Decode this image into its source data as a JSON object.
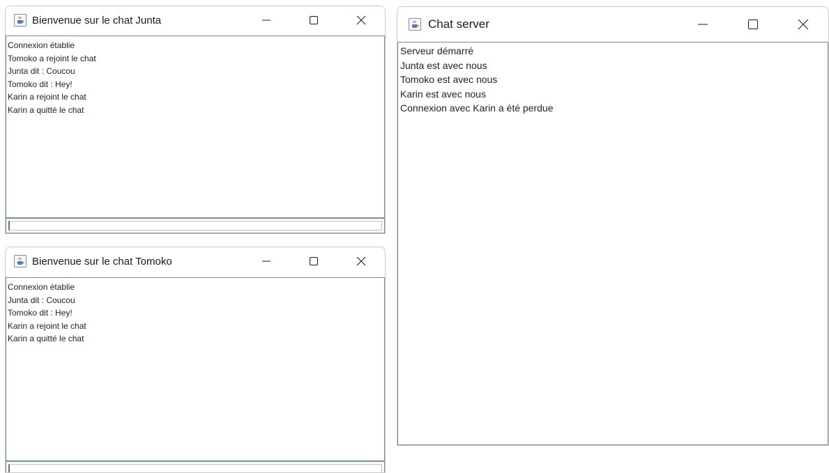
{
  "windows": {
    "junta": {
      "title": "Bienvenue sur le chat Junta",
      "messages": [
        "Connexion établie",
        "Tomoko a rejoint le chat",
        "Junta dit : Coucou",
        "Tomoko dit : Hey!",
        "Karin a rejoint le chat",
        "Karin a quitté le chat"
      ],
      "input_value": ""
    },
    "tomoko": {
      "title": "Bienvenue sur le chat Tomoko",
      "messages": [
        "Connexion établie",
        "Junta dit : Coucou",
        "Tomoko dit : Hey!",
        "Karin a rejoint le chat",
        "Karin a quitté le chat"
      ],
      "input_value": ""
    },
    "server": {
      "title": "Chat server",
      "messages": [
        "Serveur démarré",
        "Junta est avec nous",
        "Tomoko est avec nous",
        "Karin est avec nous",
        "Connexion avec Karin a été perdue"
      ]
    }
  },
  "icons": {
    "app": "java-coffee-cup-icon",
    "minimize": "minimize-icon",
    "maximize": "maximize-icon",
    "close": "close-icon"
  }
}
